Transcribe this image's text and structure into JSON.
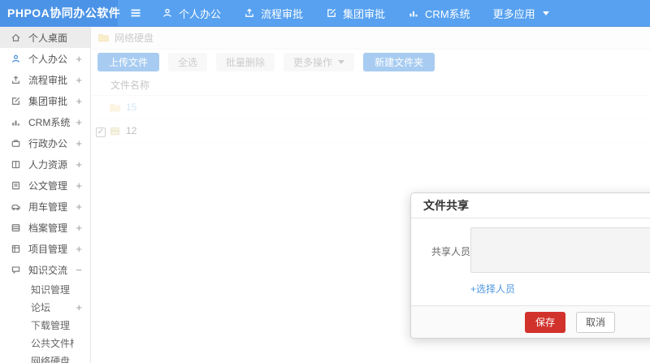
{
  "header": {
    "logo": "PHPOA协同办公软件",
    "nav": [
      {
        "label": "个人办公",
        "icon": "user-icon"
      },
      {
        "label": "流程审批",
        "icon": "flow-icon"
      },
      {
        "label": "集团审批",
        "icon": "edit-icon"
      },
      {
        "label": "CRM系统",
        "icon": "chart-icon"
      },
      {
        "label": "更多应用",
        "icon": "caret-down-icon"
      }
    ]
  },
  "sidebar": {
    "items": [
      {
        "label": "个人桌面",
        "icon": "home-icon",
        "expand": "",
        "selected": true
      },
      {
        "label": "个人办公",
        "icon": "user-icon",
        "expand": "+"
      },
      {
        "label": "流程审批",
        "icon": "flow-icon",
        "expand": "+"
      },
      {
        "label": "集团审批",
        "icon": "edit-icon",
        "expand": "+"
      },
      {
        "label": "CRM系统",
        "icon": "chart-icon",
        "expand": "+"
      },
      {
        "label": "行政办公",
        "icon": "briefcase-icon",
        "expand": "+"
      },
      {
        "label": "人力资源",
        "icon": "book-icon",
        "expand": "+"
      },
      {
        "label": "公文管理",
        "icon": "document-icon",
        "expand": "+"
      },
      {
        "label": "用车管理",
        "icon": "car-icon",
        "expand": "+"
      },
      {
        "label": "档案管理",
        "icon": "archive-icon",
        "expand": "+"
      },
      {
        "label": "项目管理",
        "icon": "project-icon",
        "expand": "+"
      },
      {
        "label": "知识交流",
        "icon": "chat-icon",
        "expand": "−"
      }
    ],
    "submenu": [
      {
        "label": "知识管理",
        "expand": ""
      },
      {
        "label": "论坛",
        "expand": "+"
      },
      {
        "label": "下载管理",
        "expand": ""
      },
      {
        "label": "公共文件柜",
        "expand": ""
      },
      {
        "label": "网络硬盘",
        "expand": ""
      }
    ]
  },
  "content": {
    "breadcrumb": {
      "icon": "folder-icon",
      "label": "网络硬盘"
    },
    "toolbar": {
      "upload": "上传文件",
      "select_all": "全选",
      "batch_delete": "批量删除",
      "more_actions": "更多操作",
      "new_folder": "新建文件夹"
    },
    "table": {
      "name_header": "文件名称",
      "rows": [
        {
          "name": "15",
          "icon": "folder-icon",
          "checked": false
        },
        {
          "name": "12",
          "icon": "zip-file-icon",
          "checked": true
        }
      ]
    }
  },
  "modal": {
    "title": "文件共享",
    "share_label": "共享人员",
    "textarea_value": "",
    "select_link": "+选择人员",
    "save": "保存",
    "cancel": "取消"
  },
  "icons": {
    "check": "✓"
  },
  "colors": {
    "header_blue": "#57a1f0",
    "logo_blue": "#4b93e6",
    "primary_button": "#3e8ee0",
    "save_red": "#d2322c",
    "link_blue": "#4e97e0",
    "folder_yellow": "#f3d78b"
  }
}
